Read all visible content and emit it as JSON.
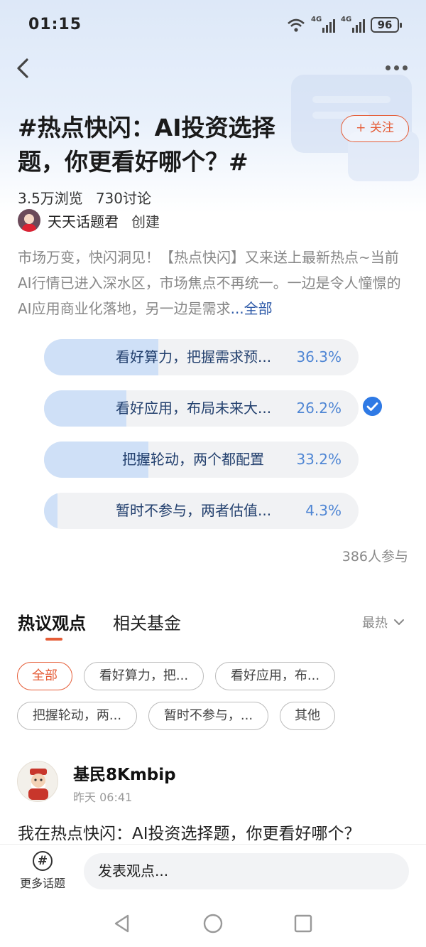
{
  "status_bar": {
    "time": "01:15",
    "net1": "4G",
    "net2": "4G",
    "battery": "96"
  },
  "nav": {
    "back_icon": "chevron-left-icon",
    "more_icon": "more-dots-icon"
  },
  "topic": {
    "title": "#热点快闪：AI投资选择题，你更看好哪个？#",
    "follow_label": "+ 关注",
    "views": "3.5万浏览",
    "discussions": "730讨论",
    "creator_name": "天天话题君",
    "creator_role": "创建",
    "description": "市场万变，快闪洞见！【热点快闪】又来送上最新热点~当前AI行情已进入深水区，市场焦点不再统一。一边是令人憧憬的AI应用商业化落地，另一边是需求",
    "description_more": "...全部"
  },
  "poll": {
    "options": [
      {
        "label": "看好算力，把握需求预...",
        "percent_label": "36.3%",
        "percent": 36.3
      },
      {
        "label": "看好应用，布局未来大...",
        "percent_label": "26.2%",
        "percent": 26.2,
        "selected": true
      },
      {
        "label": "把握轮动，两个都配置",
        "percent_label": "33.2%",
        "percent": 33.2
      },
      {
        "label": "暂时不参与，两者估值...",
        "percent_label": "4.3%",
        "percent": 4.3
      }
    ],
    "participants": "386人参与"
  },
  "tabs": {
    "active": "热议观点",
    "second": "相关基金",
    "sort": "最热"
  },
  "filters": [
    "全部",
    "看好算力，把...",
    "看好应用，布...",
    "把握轮动，两...",
    "暂时不参与，...",
    "其他"
  ],
  "post": {
    "username": "基民8Kmbip",
    "time": "昨天 06:41",
    "text": "我在热点快闪：AI投资选择题，你更看好哪个？"
  },
  "bottom": {
    "more_topics": "更多话题",
    "input_placeholder": "发表观点..."
  },
  "colors": {
    "accent": "#e55c36",
    "link": "#2e5aa8",
    "poll_fill": "#cfe0f7",
    "poll_pct": "#4f86d4",
    "check": "#2f7ae5"
  }
}
